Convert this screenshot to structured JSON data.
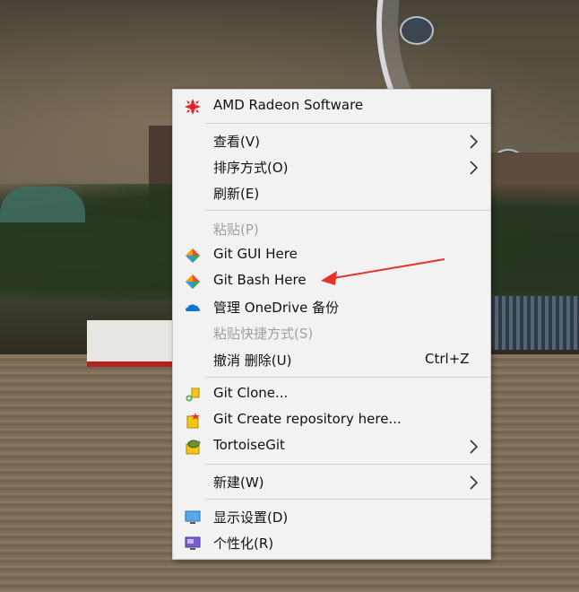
{
  "context_menu": {
    "items": [
      {
        "label": "AMD Radeon Software",
        "icon": "amd-radeon-icon"
      },
      {
        "label": "查看(V)",
        "submenu": true
      },
      {
        "label": "排序方式(O)",
        "submenu": true
      },
      {
        "label": "刷新(E)"
      },
      {
        "label": "粘贴(P)",
        "disabled": true
      },
      {
        "label": "Git GUI Here",
        "icon": "git-icon"
      },
      {
        "label": "Git Bash Here",
        "icon": "git-icon"
      },
      {
        "label": "管理 OneDrive 备份",
        "icon": "onedrive-cloud-icon"
      },
      {
        "label": "粘贴快捷方式(S)",
        "disabled": true
      },
      {
        "label": "撤消 删除(U)",
        "shortcut": "Ctrl+Z"
      },
      {
        "label": "Git Clone...",
        "icon": "tortoisegit-clone-icon"
      },
      {
        "label": "Git Create repository here...",
        "icon": "tortoisegit-create-repo-icon"
      },
      {
        "label": "TortoiseGit",
        "icon": "tortoisegit-icon",
        "submenu": true
      },
      {
        "label": "新建(W)",
        "submenu": true
      },
      {
        "label": "显示设置(D)",
        "icon": "display-settings-icon"
      },
      {
        "label": "个性化(R)",
        "icon": "personalize-icon"
      }
    ]
  },
  "colors": {
    "menu_background": "#f2f2f2",
    "disabled_text": "#a0a0a0",
    "annotation_arrow": "#e8302a"
  }
}
